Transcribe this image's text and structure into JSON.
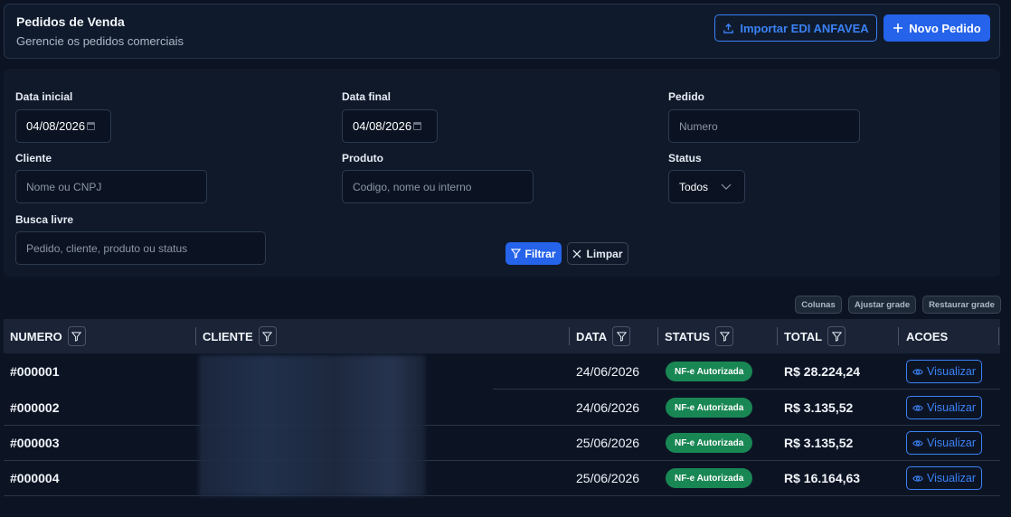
{
  "header": {
    "title": "Pedidos de Venda",
    "subtitle": "Gerencie os pedidos comerciais",
    "import_label": "Importar EDI ANFAVEA",
    "new_label": "Novo Pedido"
  },
  "filters": {
    "start_date_label": "Data inicial",
    "start_date_value": "04/08/2026",
    "end_date_label": "Data final",
    "end_date_value": "04/08/2026",
    "order_label": "Pedido",
    "order_placeholder": "Numero",
    "client_label": "Cliente",
    "client_placeholder": "Nome ou CNPJ",
    "product_label": "Produto",
    "product_placeholder": "Codigo, nome ou interno",
    "status_label": "Status",
    "status_value": "Todos",
    "search_label": "Busca livre",
    "search_placeholder": "Pedido, cliente, produto ou status",
    "filter_button": "Filtrar",
    "clear_button": "Limpar"
  },
  "grid_controls": {
    "columns": "Colunas",
    "fit": "Ajustar grade",
    "restore": "Restaurar grade"
  },
  "table": {
    "headers": [
      "NUMERO",
      "CLIENTE",
      "DATA",
      "STATUS",
      "TOTAL",
      "ACOES"
    ],
    "rows": [
      {
        "numero": "#000001",
        "data": "24/06/2026",
        "status": "NF-e Autorizada",
        "total": "R$ 28.224,24",
        "action": "Visualizar"
      },
      {
        "numero": "#000002",
        "data": "24/06/2026",
        "status": "NF-e Autorizada",
        "total": "R$ 3.135,52",
        "action": "Visualizar"
      },
      {
        "numero": "#000003",
        "data": "25/06/2026",
        "status": "NF-e Autorizada",
        "total": "R$ 3.135,52",
        "action": "Visualizar"
      },
      {
        "numero": "#000004",
        "data": "25/06/2026",
        "status": "NF-e Autorizada",
        "total": "R$ 16.164,63",
        "action": "Visualizar"
      }
    ]
  },
  "colors": {
    "background": "#0c1424",
    "accent": "#2563eb",
    "success": "#198754"
  }
}
